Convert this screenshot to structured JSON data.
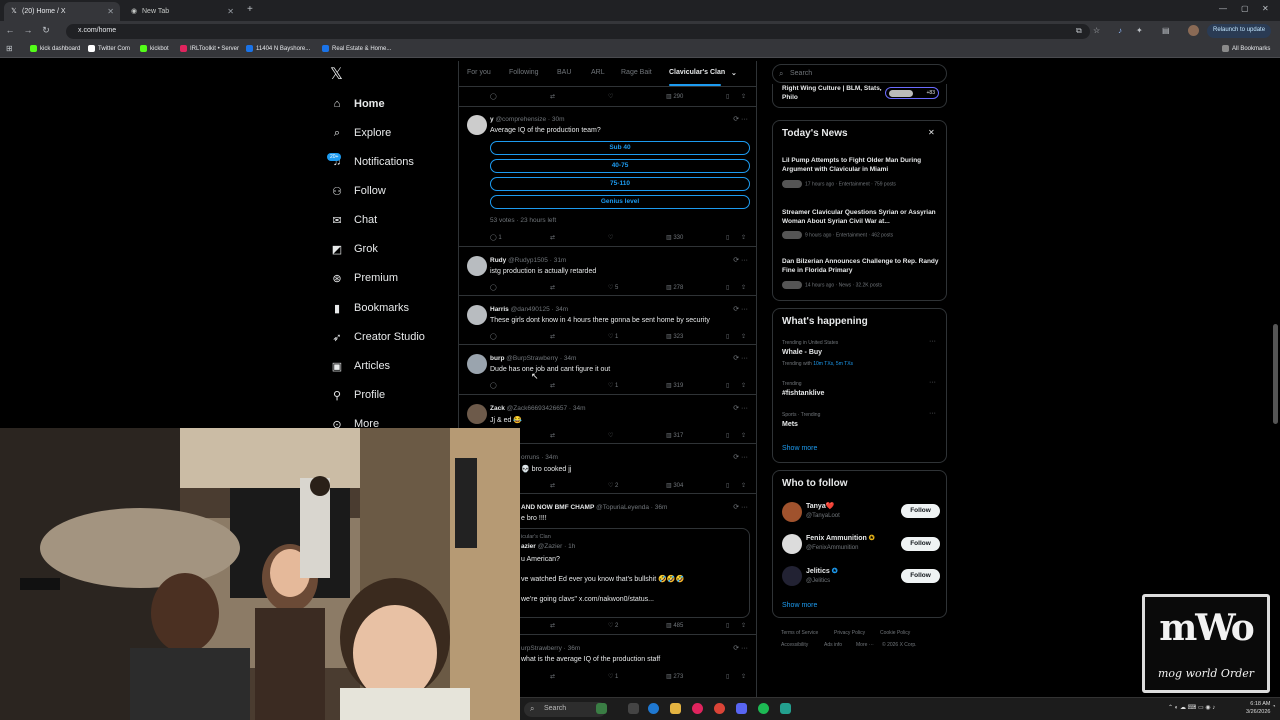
{
  "browser": {
    "tabs": [
      {
        "title": "(20) Home / X",
        "active": true
      },
      {
        "title": "New Tab",
        "active": false
      }
    ],
    "url": "x.com/home",
    "relaunch_label": "Relaunch to update",
    "bookmarks": [
      "kick dashboard",
      "Twitter Com",
      "kickbot",
      "IRLToolkit • Server",
      "11404 N Bayshore...",
      "Real Estate & Home..."
    ],
    "all_bookmarks": "All Bookmarks"
  },
  "nav": {
    "items": [
      {
        "label": "Home",
        "icon": "home-icon"
      },
      {
        "label": "Explore",
        "icon": "search-icon"
      },
      {
        "label": "Notifications",
        "icon": "bell-icon"
      },
      {
        "label": "Follow",
        "icon": "person-add-icon"
      },
      {
        "label": "Chat",
        "icon": "mail-icon"
      },
      {
        "label": "Grok",
        "icon": "grok-icon"
      },
      {
        "label": "Premium",
        "icon": "x-premium-icon"
      },
      {
        "label": "Bookmarks",
        "icon": "bookmark-icon"
      },
      {
        "label": "Creator Studio",
        "icon": "rocket-icon"
      },
      {
        "label": "Articles",
        "icon": "article-icon"
      },
      {
        "label": "Profile",
        "icon": "person-icon"
      },
      {
        "label": "More",
        "icon": "more-icon"
      }
    ],
    "notif_badge": "20+"
  },
  "feed": {
    "tabs": [
      "For you",
      "Following",
      "BAU",
      "ARL",
      "Rage Bait",
      "Clavicular's Clan"
    ],
    "top_actions": {
      "views": "290"
    },
    "posts": [
      {
        "name": "y",
        "handle": "@comprehensize",
        "time": "30m",
        "text": "Average IQ of the production team?",
        "poll": [
          "Sub 40",
          "40-75",
          "75-110",
          "Genius level"
        ],
        "poll_meta": "53 votes · 23 hours left",
        "replies": "1",
        "likes": "",
        "views": "330"
      },
      {
        "name": "Rudy",
        "handle": "@Rudyp1505",
        "time": "31m",
        "text": "istg production is actually retarded",
        "replies": "",
        "likes": "5",
        "views": "278"
      },
      {
        "name": "Harris",
        "handle": "@dan490125",
        "time": "34m",
        "text": "These girls dont know in 4 hours there gonna be sent home by security",
        "replies": "",
        "likes": "1",
        "views": "323"
      },
      {
        "name": "burp",
        "handle": "@BurpStrawberry",
        "time": "34m",
        "text": "Dude has one job and cant figure it out",
        "replies": "",
        "likes": "1",
        "views": "319"
      },
      {
        "name": "Zack",
        "handle": "@Zack66693426657",
        "time": "34m",
        "text": "Jj & ed 😂",
        "replies": "",
        "likes": "",
        "views": "317"
      },
      {
        "name": "",
        "handle": "orruns",
        "time": "34m",
        "text": "💀 bro cooked jj",
        "replies": "",
        "likes": "2",
        "views": "304"
      },
      {
        "name": "AND NOW BMF CHAMP",
        "handle": "@TopuriaLeyenda",
        "time": "36m",
        "text": "e bro !!!!",
        "quote": {
          "context": "icular's Clan",
          "author": "azier",
          "handle": "@Zazier",
          "time": "1h",
          "lines": [
            "u American?",
            "ve watched Ed ever you know that's bullshit 🤣🤣🤣",
            "we're going clavs\" x.com/nakwon0/status..."
          ]
        },
        "replies": "",
        "likes": "2",
        "views": "485"
      },
      {
        "name": "",
        "handle": "urpStrawberry",
        "time": "36m",
        "text": "what is the average IQ of the production staff",
        "replies": "",
        "likes": "1",
        "views": "273"
      }
    ]
  },
  "right": {
    "search_placeholder": "Search",
    "community": {
      "title": "Right Wing Culture | BLM, Stats, Philo",
      "count": "+83"
    },
    "todays_news": {
      "title": "Today's News",
      "items": [
        {
          "headline": "Lil Pump Attempts to Fight Older Man During Argument with Clavicular in Miami",
          "meta": "17 hours ago · Entertainment · 759 posts"
        },
        {
          "headline": "Streamer Clavicular Questions Syrian or Assyrian Woman About Syrian Civil War at...",
          "meta": "9 hours ago · Entertainment · 462 posts"
        },
        {
          "headline": "Dan Bilzerian Announces Challenge to Rep. Randy Fine in Florida Primary",
          "meta": "14 hours ago · News · 32.2K posts"
        }
      ]
    },
    "happening": {
      "title": "What's happening",
      "trends": [
        {
          "context": "Trending in United States",
          "name": "Whale - Buy",
          "sub": "Trending with",
          "sub_link": "10m TXs, 5m TXs"
        },
        {
          "context": "Trending",
          "name": "#fishtanklive"
        },
        {
          "context": "Sports · Trending",
          "name": "Mets"
        }
      ],
      "show_more": "Show more"
    },
    "who_to_follow": {
      "title": "Who to follow",
      "users": [
        {
          "name": "Tanya❤️",
          "handle": "@TanyaLoot"
        },
        {
          "name": "Fenix Ammunition",
          "handle": "@FenixAmmunition"
        },
        {
          "name": "Jelitics",
          "handle": "@Jelitics"
        }
      ],
      "follow_label": "Follow",
      "show_more": "Show more"
    },
    "footer": [
      "Terms of Service",
      "Privacy Policy",
      "Cookie Policy",
      "Accessibility",
      "Ads info",
      "More ···",
      "© 2026 X Corp."
    ]
  },
  "overlay": {
    "logo_line1": "mWo",
    "logo_line2": "mog world Order"
  },
  "taskbar": {
    "search": "Search",
    "time": "6:18 AM",
    "date": "3/26/2026"
  },
  "colors": {
    "accent": "#1d9bf0",
    "background": "#000000",
    "border": "#2f3336",
    "muted": "#71767b"
  }
}
